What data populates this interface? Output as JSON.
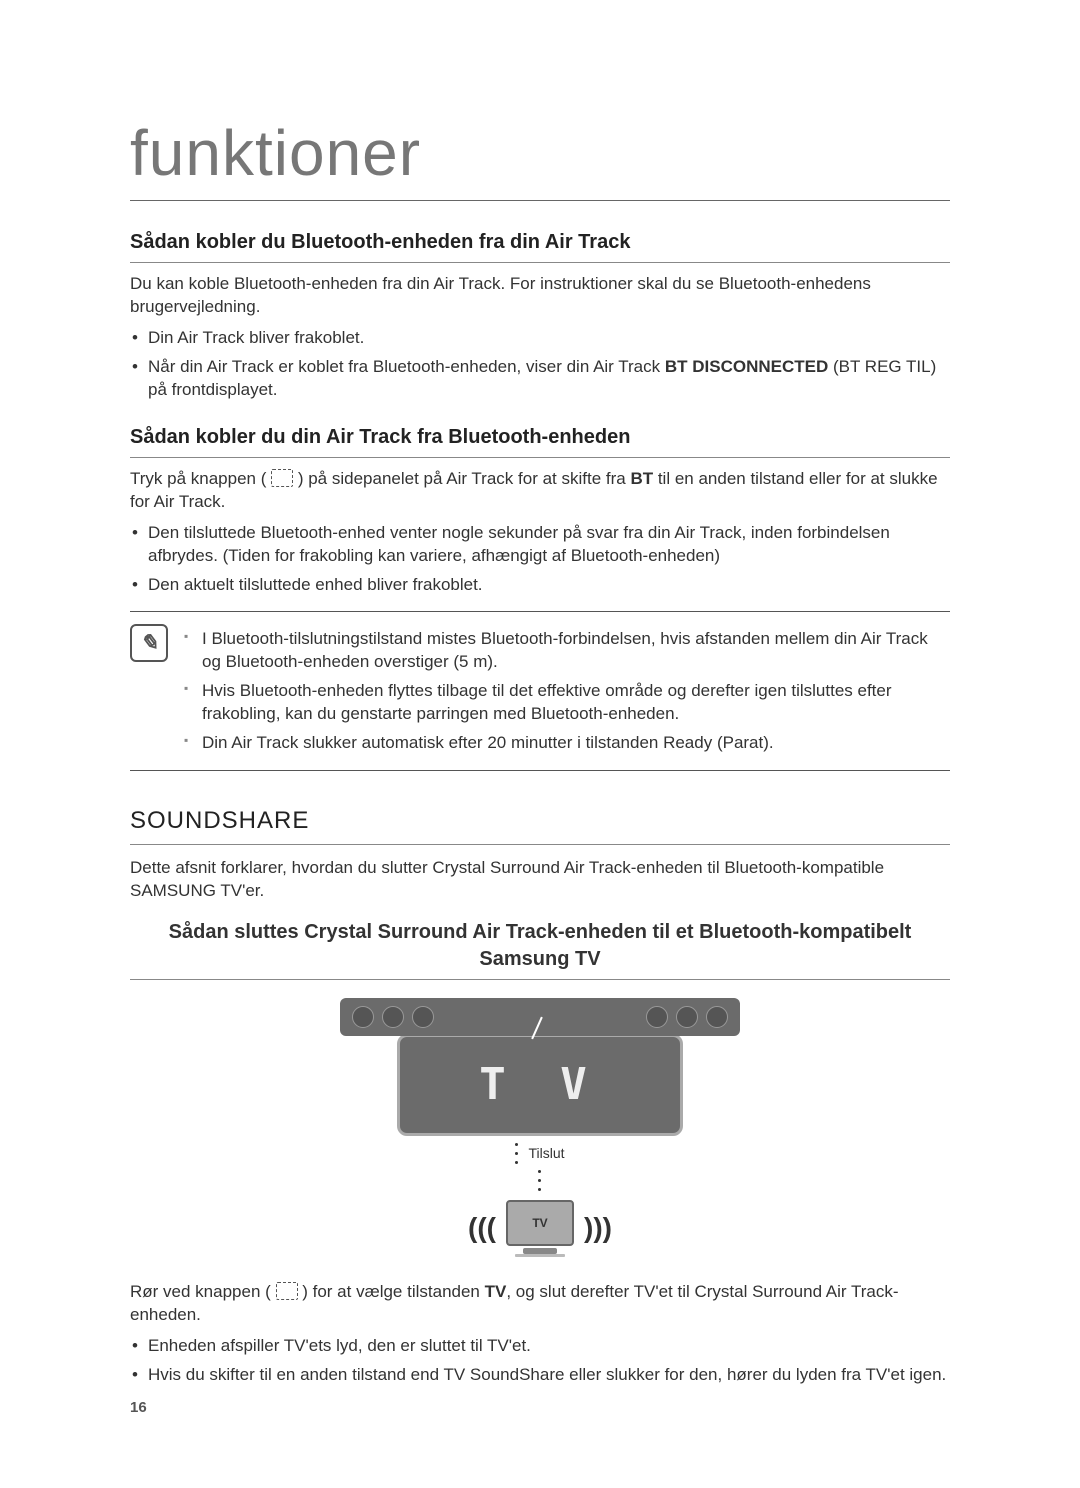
{
  "title": "funktioner",
  "section1": {
    "heading": "Sådan kobler du Bluetooth-enheden fra din Air Track",
    "intro": "Du kan koble Bluetooth-enheden fra din Air Track. For instruktioner skal du se Bluetooth-enhedens brugervejledning.",
    "bullets": {
      "b1": "Din Air Track bliver frakoblet.",
      "b2_pre": "Når din Air Track er koblet fra Bluetooth-enheden, viser din Air Track ",
      "b2_bold": "BT DISCONNECTED",
      "b2_post": " (BT REG TIL) på frontdisplayet."
    }
  },
  "section2": {
    "heading": "Sådan kobler du din Air Track fra Bluetooth-enheden",
    "intro_pre": "Tryk på knappen ( ",
    "intro_mid": " ) på sidepanelet på Air Track for at skifte fra ",
    "intro_bold": "BT",
    "intro_post": " til en anden tilstand eller for at slukke for Air Track.",
    "bullets": {
      "b1": "Den tilsluttede Bluetooth-enhed venter nogle sekunder på svar fra din Air Track, inden forbindelsen afbrydes. (Tiden for frakobling kan variere, afhængigt af Bluetooth-enheden)",
      "b2": "Den aktuelt tilsluttede enhed bliver frakoblet."
    }
  },
  "note": {
    "n1": "I Bluetooth-tilslutningstilstand mistes Bluetooth-forbindelsen, hvis afstanden mellem din Air Track og Bluetooth-enheden overstiger (5 m).",
    "n2": "Hvis Bluetooth-enheden flyttes tilbage til det effektive område og derefter igen tilsluttes efter frakobling, kan du genstarte parringen med Bluetooth-enheden.",
    "n3": "Din Air Track slukker automatisk efter 20 minutter i tilstanden Ready (Parat)."
  },
  "soundshare": {
    "title": "SOUNDSHARE",
    "intro": "Dette afsnit forklarer, hvordan du slutter Crystal Surround Air Track-enheden til Bluetooth-kompatible SAMSUNG TV'er.",
    "subheading": "Sådan sluttes Crystal Surround Air Track-enheden til et Bluetooth-kompatibelt Samsung TV"
  },
  "diagram": {
    "dots_label": "T V",
    "connect_label": "Tilslut",
    "tv_label": "TV"
  },
  "section3": {
    "intro_pre": "Rør ved knappen ( ",
    "intro_mid": " ) for at vælge tilstanden ",
    "intro_bold": "TV",
    "intro_post": ", og slut derefter TV'et til Crystal Surround Air Track-enheden.",
    "bullets": {
      "b1": "Enheden afspiller TV'ets lyd, den er sluttet til TV'et.",
      "b2": "Hvis du skifter til en anden tilstand end TV SoundShare eller slukker for den, hører du lyden fra TV'et igen."
    }
  },
  "page_number": "16"
}
